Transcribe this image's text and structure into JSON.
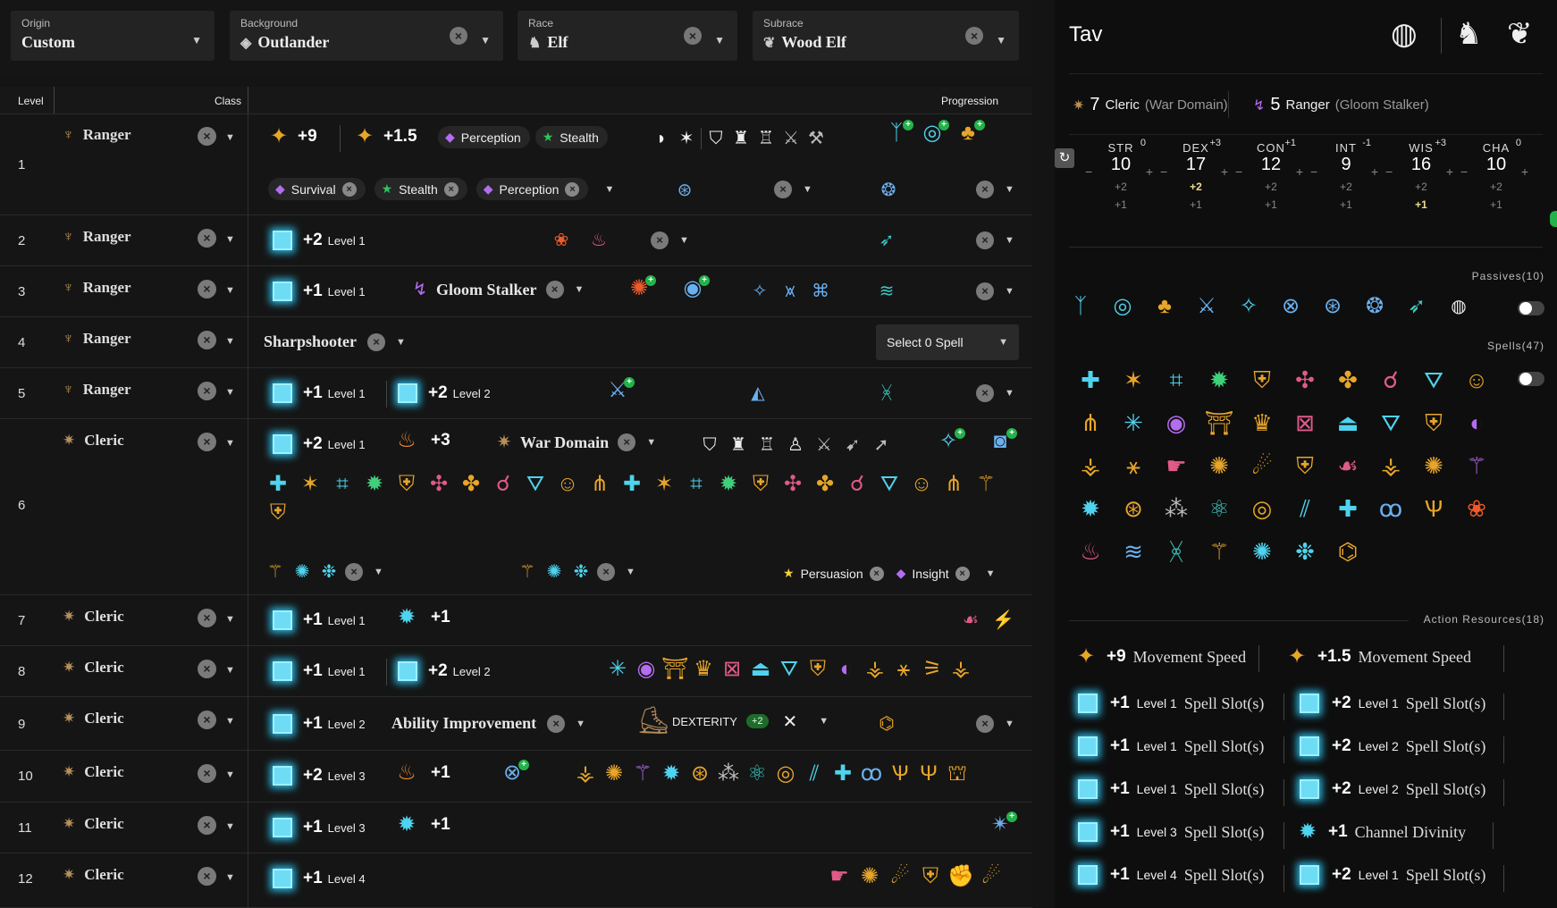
{
  "selectors": {
    "origin": {
      "label": "Origin",
      "value": "Custom"
    },
    "background": {
      "label": "Background",
      "value": "Outlander"
    },
    "race": {
      "label": "Race",
      "value": "Elf"
    },
    "subrace": {
      "label": "Subrace",
      "value": "Wood Elf"
    }
  },
  "table_header": {
    "level": "Level",
    "class": "Class",
    "progression": "Progression"
  },
  "rows": [
    {
      "level": "1",
      "class": "Ranger"
    },
    {
      "level": "2",
      "class": "Ranger"
    },
    {
      "level": "3",
      "class": "Ranger"
    },
    {
      "level": "4",
      "class": "Ranger"
    },
    {
      "level": "5",
      "class": "Ranger"
    },
    {
      "level": "6",
      "class": "Cleric"
    },
    {
      "level": "7",
      "class": "Cleric"
    },
    {
      "level": "8",
      "class": "Cleric"
    },
    {
      "level": "9",
      "class": "Cleric"
    },
    {
      "level": "10",
      "class": "Cleric"
    },
    {
      "level": "11",
      "class": "Cleric"
    },
    {
      "level": "12",
      "class": "Cleric"
    }
  ],
  "prog": {
    "r1": {
      "speed1": "+9",
      "speed2": "+1.5",
      "skill1": "Perception",
      "skill2": "Stealth",
      "c1": "Survival",
      "c2": "Stealth",
      "c3": "Perception"
    },
    "r2": {
      "slot": "+2",
      "lvl": "Level 1"
    },
    "r3": {
      "slot": "+1",
      "lvl": "Level 1",
      "subclass": "Gloom Stalker"
    },
    "r4": {
      "feat": "Sharpshooter",
      "select": "Select 0 Spell"
    },
    "r5": {
      "s1": "+1",
      "l1": "Level 1",
      "s2": "+2",
      "l2": "Level 2"
    },
    "r6": {
      "s1": "+2",
      "l1": "Level 1",
      "cd": "+3",
      "domain": "War Domain",
      "skill1": "Persuasion",
      "skill2": "Insight"
    },
    "r7": {
      "s1": "+1",
      "l1": "Level 1",
      "cd": "+1"
    },
    "r8": {
      "s1": "+1",
      "l1": "Level 1",
      "s2": "+2",
      "l2": "Level 2"
    },
    "r9": {
      "s1": "+1",
      "l1": "Level 2",
      "feat": "Ability Improvement",
      "ability": "DEXTERITY",
      "bonus": "+2"
    },
    "r10": {
      "s1": "+2",
      "l1": "Level 3",
      "cd": "+1"
    },
    "r11": {
      "s1": "+1",
      "l1": "Level 3",
      "cd": "+1"
    },
    "r12": {
      "s1": "+1",
      "l1": "Level 4"
    }
  },
  "panel": {
    "name": "Tav",
    "class1": {
      "lvl": "7",
      "name": "Cleric",
      "sub": "(War Domain)"
    },
    "class2": {
      "lvl": "5",
      "name": "Ranger",
      "sub": "(Gloom Stalker)"
    },
    "stats": [
      {
        "name": "STR",
        "mod": "0",
        "value": "10",
        "b1": "+2",
        "b2": "+1"
      },
      {
        "name": "DEX",
        "mod": "+3",
        "value": "17",
        "b1": "+2",
        "b2": "+1"
      },
      {
        "name": "CON",
        "mod": "+1",
        "value": "12",
        "b1": "+2",
        "b2": "+1"
      },
      {
        "name": "INT",
        "mod": "-1",
        "value": "9",
        "b1": "+2",
        "b2": "+1"
      },
      {
        "name": "WIS",
        "mod": "+3",
        "value": "16",
        "b1": "+2",
        "b2": "+1"
      },
      {
        "name": "CHA",
        "mod": "0",
        "value": "10",
        "b1": "+2",
        "b2": "+1"
      }
    ],
    "passives_title": "Passives",
    "passives_count": "10",
    "spells_title": "Spells",
    "spells_count": "47",
    "resources_title": "Action Resources",
    "resources_count": "18",
    "resources": [
      {
        "v": "+9",
        "l": "",
        "t": "Movement Speed"
      },
      {
        "v": "+1.5",
        "l": "",
        "t": "Movement Speed"
      },
      {
        "v": "+1",
        "l": "Level 1",
        "t": "Spell Slot(s)"
      },
      {
        "v": "+2",
        "l": "Level 1",
        "t": "Spell Slot(s)"
      },
      {
        "v": "+1",
        "l": "Level 1",
        "t": "Spell Slot(s)"
      },
      {
        "v": "+2",
        "l": "Level 2",
        "t": "Spell Slot(s)"
      },
      {
        "v": "+1",
        "l": "Level 1",
        "t": "Spell Slot(s)"
      },
      {
        "v": "+2",
        "l": "Level 2",
        "t": "Spell Slot(s)"
      },
      {
        "v": "+1",
        "l": "Level 3",
        "t": "Spell Slot(s)"
      },
      {
        "v": "+1",
        "l": "",
        "t": "Channel Divinity"
      },
      {
        "v": "+1",
        "l": "Level 4",
        "t": "Spell Slot(s)"
      },
      {
        "v": "+2",
        "l": "Level 1",
        "t": "Spell Slot(s)"
      }
    ]
  },
  "icons": {
    "slot": "spell-slot-icon",
    "speed": "movement-speed-icon",
    "channel": "channel-divinity-icon"
  }
}
